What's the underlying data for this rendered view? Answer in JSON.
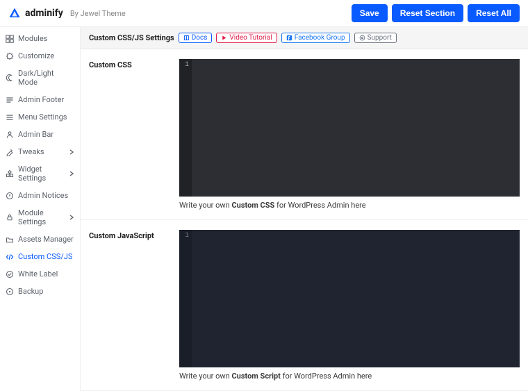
{
  "brand": {
    "name": "adminify",
    "byline": "By Jewel Theme"
  },
  "actions": {
    "save": "Save",
    "reset_section": "Reset Section",
    "reset_all": "Reset All"
  },
  "sidebar": {
    "items": [
      {
        "label": "Modules",
        "icon": "modules-icon"
      },
      {
        "label": "Customize",
        "icon": "customize-icon"
      },
      {
        "label": "Dark/Light Mode",
        "icon": "darklight-icon"
      },
      {
        "label": "Admin Footer",
        "icon": "footer-icon"
      },
      {
        "label": "Menu Settings",
        "icon": "menu-icon"
      },
      {
        "label": "Admin Bar",
        "icon": "adminbar-icon"
      },
      {
        "label": "Tweaks",
        "icon": "tweaks-icon",
        "chevron": true
      },
      {
        "label": "Widget Settings",
        "icon": "widget-icon",
        "chevron": true
      },
      {
        "label": "Admin Notices",
        "icon": "notices-icon"
      },
      {
        "label": "Module Settings",
        "icon": "modulesettings-icon",
        "chevron": true
      },
      {
        "label": "Assets Manager",
        "icon": "assets-icon"
      },
      {
        "label": "Custom CSS/JS",
        "icon": "code-icon",
        "active": true
      },
      {
        "label": "White Label",
        "icon": "whitelabel-icon"
      },
      {
        "label": "Backup",
        "icon": "backup-icon"
      }
    ]
  },
  "header": {
    "title": "Custom CSS/JS Settings",
    "chips": [
      {
        "label": "Docs",
        "kind": "blue",
        "icon": "book-icon"
      },
      {
        "label": "Video Tutorial",
        "kind": "red",
        "icon": "play-icon"
      },
      {
        "label": "Facebook Group",
        "kind": "fb",
        "icon": "facebook-icon"
      },
      {
        "label": "Support",
        "kind": "gray",
        "icon": "support-icon"
      }
    ]
  },
  "sections": {
    "css": {
      "label": "Custom CSS",
      "line_start": "1",
      "hint_pre": "Write your own ",
      "hint_strong": "Custom CSS",
      "hint_post": " for WordPress Admin here"
    },
    "js": {
      "label": "Custom JavaScript",
      "line_start": "1",
      "hint_pre": "Write your own ",
      "hint_strong": "Custom Script",
      "hint_post": " for WordPress Admin here"
    }
  }
}
